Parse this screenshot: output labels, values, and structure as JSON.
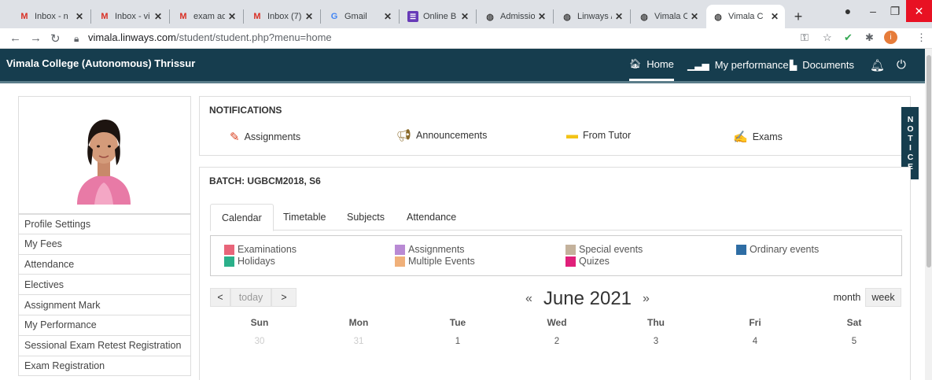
{
  "browser": {
    "tabs": [
      {
        "label": "Inbox - n",
        "favicon": "gmail-icon",
        "active": false
      },
      {
        "label": "Inbox - vi",
        "favicon": "gmail-icon",
        "active": false
      },
      {
        "label": "exam adi",
        "favicon": "gmail-icon",
        "active": false
      },
      {
        "label": "Inbox (7)",
        "favicon": "gmail-icon",
        "active": false
      },
      {
        "label": "Gmail",
        "favicon": "google-icon",
        "active": false
      },
      {
        "label": "Online B",
        "favicon": "forms-icon",
        "active": false
      },
      {
        "label": "Admissio",
        "favicon": "globe-icon",
        "active": false
      },
      {
        "label": "Linways /",
        "favicon": "globe-icon",
        "active": false
      },
      {
        "label": "Vimala C",
        "favicon": "globe-icon",
        "active": false
      },
      {
        "label": "Vimala C",
        "favicon": "globe-icon",
        "active": true
      }
    ],
    "new_tab": "+",
    "url_host": "vimala.linways.com",
    "url_path": "/student/student.php?menu=home"
  },
  "navbar": {
    "brand": "Vimala College (Autonomous) Thrissur",
    "items": [
      {
        "label": "Home",
        "icon": "home-icon",
        "active": true
      },
      {
        "label": "My performance",
        "icon": "bar-chart-icon",
        "active": false
      },
      {
        "label": "Documents",
        "icon": "document-icon",
        "active": false
      }
    ]
  },
  "sidebar": {
    "items": [
      {
        "label": "Profile Settings"
      },
      {
        "label": "My Fees"
      },
      {
        "label": "Attendance"
      },
      {
        "label": "Electives"
      },
      {
        "label": "Assignment Mark"
      },
      {
        "label": "My Performance"
      },
      {
        "label": "Sessional Exam Retest Registration"
      },
      {
        "label": "Exam Registration"
      }
    ]
  },
  "notifications": {
    "title": "NOTIFICATIONS",
    "items": [
      {
        "label": "Assignments",
        "icon": "pencil-icon"
      },
      {
        "label": "Announcements",
        "icon": "megaphone-icon"
      },
      {
        "label": "From Tutor",
        "icon": "folder-icon"
      },
      {
        "label": "Exams",
        "icon": "exam-pen-icon"
      }
    ],
    "notice_tab": "NOTICE"
  },
  "batch": {
    "title": "BATCH: UGBCM2018, S6",
    "tabs": [
      "Calendar",
      "Timetable",
      "Subjects",
      "Attendance"
    ],
    "active_tab": "Calendar",
    "legend": [
      {
        "label": "Examinations",
        "color": "#e8657a"
      },
      {
        "label": "Assignments",
        "color": "#b98ad4"
      },
      {
        "label": "Special events",
        "color": "#c4b29c"
      },
      {
        "label": "Ordinary events",
        "color": "#2e6da4"
      },
      {
        "label": "Holidays",
        "color": "#2bb08a"
      },
      {
        "label": "Multiple Events",
        "color": "#f0b07a"
      },
      {
        "label": "Quizes",
        "color": "#e0207a"
      }
    ]
  },
  "calendar": {
    "today_label": "today",
    "prev": "<",
    "next": ">",
    "prev_month": "«",
    "next_month": "»",
    "title": "June 2021",
    "view_month": "month",
    "view_week": "week",
    "days_of_week": [
      "Sun",
      "Mon",
      "Tue",
      "Wed",
      "Thu",
      "Fri",
      "Sat"
    ],
    "first_week": [
      {
        "day": "30",
        "current_month": false
      },
      {
        "day": "31",
        "current_month": false
      },
      {
        "day": "1",
        "current_month": true
      },
      {
        "day": "2",
        "current_month": true
      },
      {
        "day": "3",
        "current_month": true
      },
      {
        "day": "4",
        "current_month": true
      },
      {
        "day": "5",
        "current_month": true
      }
    ]
  }
}
